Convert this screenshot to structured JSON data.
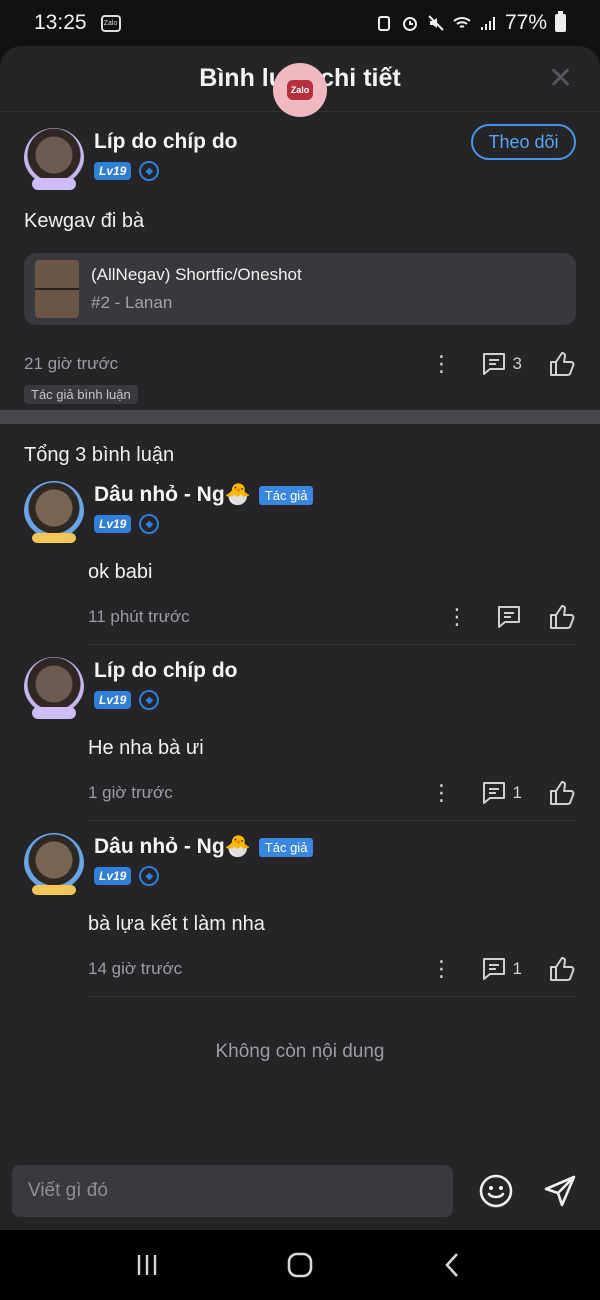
{
  "status_bar": {
    "time": "13:25",
    "app_badge": "Zalo",
    "battery": "77%"
  },
  "header": {
    "title": "Bình luận chi tiết",
    "bubble": "Zalo"
  },
  "post": {
    "author": "Líp do chíp do",
    "level": "Lv19",
    "follow": "Theo dõi",
    "text": "Kewgav đi bà",
    "story": {
      "title": "(AllNegav) Shortfic/Oneshot",
      "subtitle": "#2 - Lanan"
    },
    "time": "21 giờ trước",
    "comment_count": "3",
    "tag": "Tác giả bình luận"
  },
  "comments_header": "Tổng 3 bình luận",
  "comments": [
    {
      "author": "Dâu nhỏ - Ng🐣",
      "tag": "Tác giả",
      "level": "Lv19",
      "text": "ok babi",
      "time": "11 phút trước",
      "reply_count": ""
    },
    {
      "author": "Líp do chíp do",
      "tag": "",
      "level": "Lv19",
      "text": "He nha bà ưi",
      "time": "1 giờ trước",
      "reply_count": "1"
    },
    {
      "author": "Dâu nhỏ - Ng🐣",
      "tag": "Tác giả",
      "level": "Lv19",
      "text": "bà lựa kết t làm nha",
      "time": "14 giờ trước",
      "reply_count": "1"
    }
  ],
  "end_note": "Không còn nội dung",
  "input": {
    "placeholder": "Viết gì đó"
  },
  "colors": {
    "accent": "#4b95e6",
    "background": "#252528",
    "level_badge": "#2f7fd6"
  }
}
